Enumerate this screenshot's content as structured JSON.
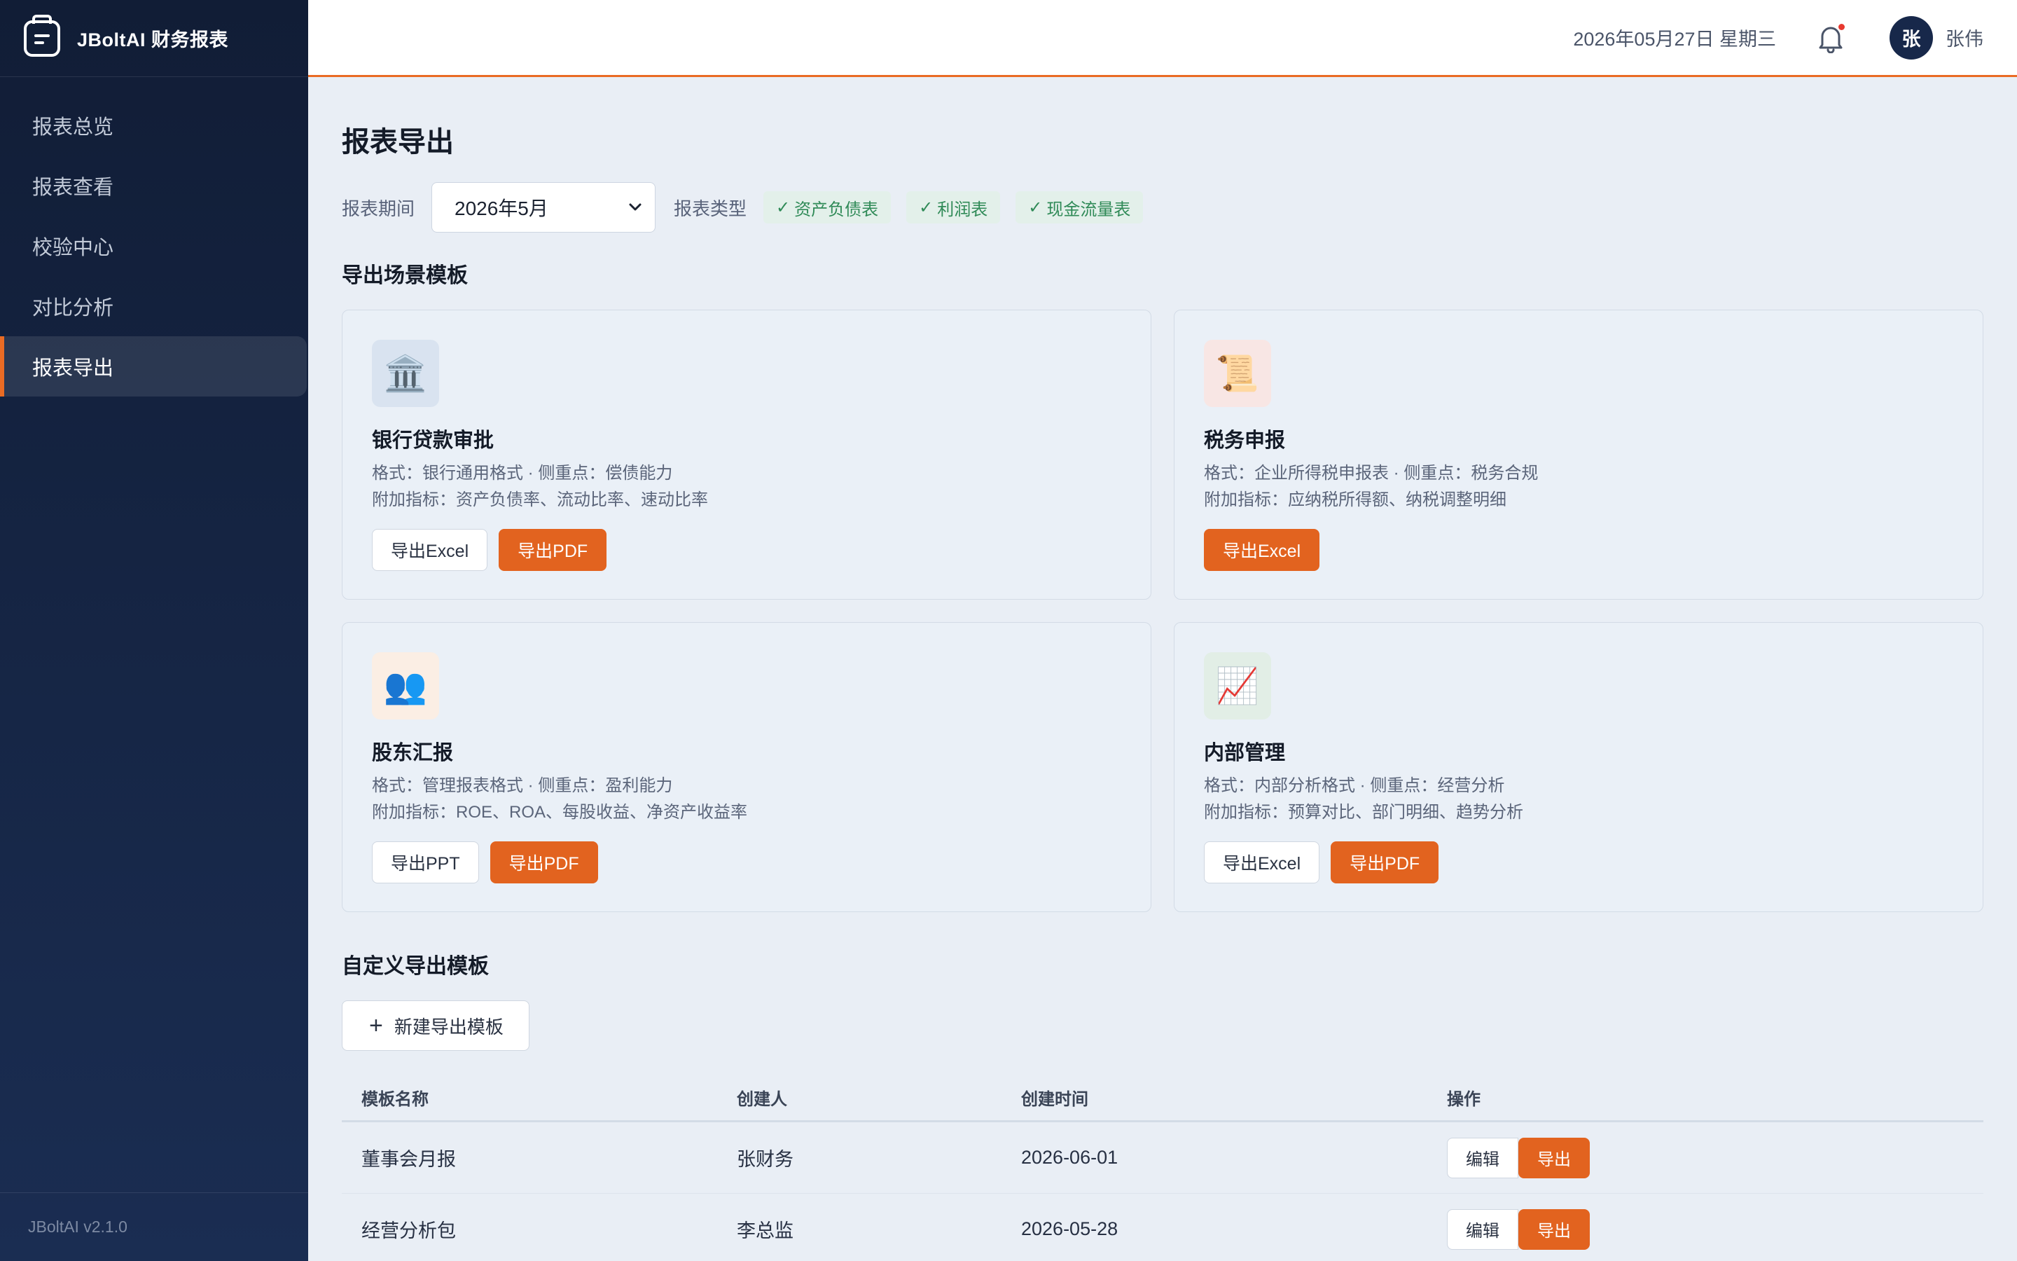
{
  "app": {
    "title": "JBoltAI 财务报表",
    "version": "JBoltAI v2.1.0"
  },
  "sidebar": {
    "items": [
      {
        "label": "报表总览",
        "active": false
      },
      {
        "label": "报表查看",
        "active": false
      },
      {
        "label": "校验中心",
        "active": false
      },
      {
        "label": "对比分析",
        "active": false
      },
      {
        "label": "报表导出",
        "active": true
      }
    ]
  },
  "header": {
    "date": "2026年05月27日 星期三",
    "notification_icon": "bell-icon",
    "user": {
      "avatar_text": "张",
      "name": "张伟"
    }
  },
  "page": {
    "title": "报表导出",
    "filters": {
      "period_label": "报表期间",
      "period_value": "2026年5月",
      "type_label": "报表类型",
      "types": [
        {
          "label": "资产负债表",
          "checked": true
        },
        {
          "label": "利润表",
          "checked": true
        },
        {
          "label": "现金流量表",
          "checked": true
        }
      ],
      "check_mark": "✓"
    },
    "scenario_title": "导出场景模板",
    "scenarios": [
      {
        "icon": "🏛️",
        "icon_name": "bank-icon",
        "icon_bg": "#d9e3f0",
        "title": "银行贷款审批",
        "line1": "格式：银行通用格式 · 侧重点：偿债能力",
        "line2": "附加指标：资产负债率、流动比率、速动比率",
        "buttons": [
          {
            "label": "导出Excel",
            "style": "outline"
          },
          {
            "label": "导出PDF",
            "style": "primary"
          }
        ]
      },
      {
        "icon": "📜",
        "icon_name": "scroll-icon",
        "icon_bg": "#f8e6e4",
        "title": "税务申报",
        "line1": "格式：企业所得税申报表 · 侧重点：税务合规",
        "line2": "附加指标：应纳税所得额、纳税调整明细",
        "buttons": [
          {
            "label": "导出Excel",
            "style": "primary"
          }
        ]
      },
      {
        "icon": "👥",
        "icon_name": "people-icon",
        "icon_bg": "#fbeee4",
        "title": "股东汇报",
        "line1": "格式：管理报表格式 · 侧重点：盈利能力",
        "line2": "附加指标：ROE、ROA、每股收益、净资产收益率",
        "buttons": [
          {
            "label": "导出PPT",
            "style": "outline"
          },
          {
            "label": "导出PDF",
            "style": "primary"
          }
        ]
      },
      {
        "icon": "📈",
        "icon_name": "chart-increasing-icon",
        "icon_bg": "#e2eee6",
        "title": "内部管理",
        "line1": "格式：内部分析格式 · 侧重点：经营分析",
        "line2": "附加指标：预算对比、部门明细、趋势分析",
        "buttons": [
          {
            "label": "导出Excel",
            "style": "outline"
          },
          {
            "label": "导出PDF",
            "style": "primary"
          }
        ]
      }
    ],
    "custom_title": "自定义导出模板",
    "new_template_label": "新建导出模板",
    "table": {
      "columns": [
        "模板名称",
        "创建人",
        "创建时间",
        "操作"
      ],
      "rows": [
        {
          "name": "董事会月报",
          "creator": "张财务",
          "created": "2026-06-01",
          "edit": "编辑",
          "export": "导出"
        },
        {
          "name": "经营分析包",
          "creator": "李总监",
          "created": "2026-05-28",
          "edit": "编辑",
          "export": "导出"
        }
      ]
    }
  },
  "colors": {
    "accent": "#e2631f",
    "sidebar": "#111d36",
    "tag_text": "#2f8a57",
    "tag_bg": "#e3f0ea"
  }
}
